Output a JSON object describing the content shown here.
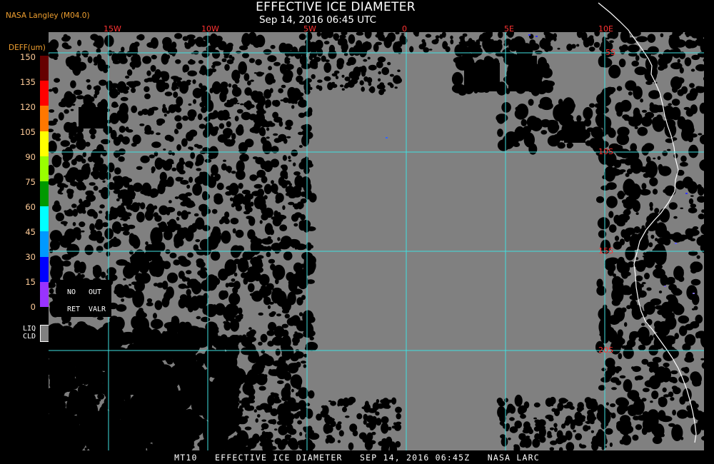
{
  "header": {
    "title": "EFFECTIVE ICE DIAMETER",
    "datetime": "Sep 14, 2016 06:45 UTC",
    "provider": "NASA Langley (M04.0)"
  },
  "footer": {
    "text": "MT10   EFFECTIVE ICE DIAMETER   SEP 14, 2016 06:45Z   NASA LARC"
  },
  "colorbar": {
    "title": "DEFF(um)",
    "ticks": [
      "150",
      "135",
      "120",
      "105",
      "90",
      "75",
      "60",
      "45",
      "30",
      "15",
      "0"
    ],
    "colors": [
      "#660000",
      "#ff0000",
      "#ff7700",
      "#ffff00",
      "#99ff00",
      "#009900",
      "#00ffff",
      "#0099ff",
      "#0000ff",
      "#9933ff"
    ],
    "no_retrieval": [
      "NO",
      "RET"
    ],
    "out_of_valid_range": [
      "OUT",
      "VALR"
    ],
    "liquid_cloud": [
      "LIQ",
      "CLD"
    ],
    "liquid_cloud_color": "#808080"
  },
  "map": {
    "background_color": "#808080",
    "no_data_color": "#000000",
    "grid_color": "#40e0e0",
    "grid_label_color": "#ff3333",
    "coast_color": "#ffffff",
    "lon_labels": [
      "15W",
      "10W",
      "5W",
      "0",
      "5E",
      "10E"
    ],
    "lat_labels": [
      "5S",
      "10S",
      "15S",
      "20S"
    ]
  }
}
